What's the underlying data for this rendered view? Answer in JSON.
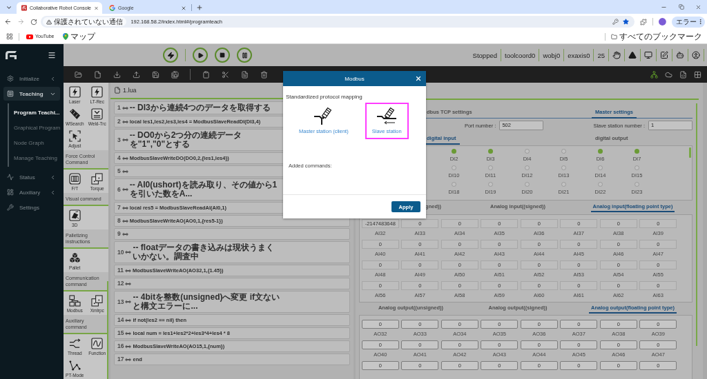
{
  "browser": {
    "tabs": [
      {
        "title": "Collaborative Robot Console",
        "selected": true
      },
      {
        "title": "Google",
        "selected": false
      }
    ],
    "security_label": "保護されていない通信",
    "url": "192.168.58.2/index.html#/programteach",
    "profile_label": "エラー",
    "bookmarks": [
      {
        "label": "YouTube"
      },
      {
        "label": "マップ"
      }
    ],
    "all_bookmarks": "すべてのブックマーク"
  },
  "sidebar": {
    "items": [
      {
        "label": "Initialize",
        "selected": false,
        "expanded": false
      },
      {
        "label": "Teaching",
        "selected": true,
        "expanded": true,
        "children": [
          {
            "label": "Program Teachi...",
            "selected": true
          },
          {
            "label": "Graphical Program",
            "selected": false
          },
          {
            "label": "Node Graph",
            "selected": false
          },
          {
            "label": "Manage Teaching",
            "selected": false
          }
        ]
      },
      {
        "label": "Status",
        "selected": false,
        "expanded": false
      },
      {
        "label": "Auxiliary",
        "selected": false,
        "expanded": false
      },
      {
        "label": "Settings",
        "selected": false
      }
    ]
  },
  "header": {
    "status": [
      "Stopped",
      "toolcoord0",
      "wobj0",
      "exaxis0",
      "25"
    ]
  },
  "command_panel": {
    "groups": [
      {
        "commands": [
          "Laser",
          "LT-Rec",
          "WSearch",
          "Weld-Trc",
          "Adjust"
        ]
      },
      {
        "title": "Force Control Command",
        "commands": [
          "F/T",
          "Torque"
        ]
      },
      {
        "title": "Visual command",
        "commands": [
          "3D"
        ]
      },
      {
        "title": "Palletizing instructions",
        "commands": [
          "Pallet"
        ]
      },
      {
        "title": "Communication command",
        "commands": [
          "Modbus",
          "Xmlrpc"
        ]
      },
      {
        "title": "Auxiliary command",
        "commands": [
          "Thread",
          "Function",
          "PT-Mode"
        ]
      }
    ]
  },
  "editor": {
    "file": "1.lua",
    "lines": [
      {
        "number": "1",
        "kind": "comment",
        "code": "-- DI3から連続4つのデータを取得する"
      },
      {
        "number": "2",
        "kind": "code",
        "code": "local les1,les2,les3,les4 = ModbusSlaveReadDI(DI3,4)"
      },
      {
        "number": "3",
        "kind": "comment",
        "code": "-- DO0から2つ分の連続データを\"1\",\"0\"とする"
      },
      {
        "number": "4",
        "kind": "code",
        "code": "ModbusSlaveWriteDO(DO0,2,{les1,les4})"
      },
      {
        "number": "5",
        "kind": "blank"
      },
      {
        "number": "6",
        "kind": "comment",
        "code": "-- AI0(ushort)を読み取り、その値から1を引いた数をA..."
      },
      {
        "number": "7",
        "kind": "code",
        "code": "local res5 = ModbusSlaveReadAI(AI0,1)"
      },
      {
        "number": "8",
        "kind": "code",
        "code": "ModbusSlaveWriteAO(AO0,1,{res5-1})"
      },
      {
        "number": "9",
        "kind": "blank"
      },
      {
        "number": "10",
        "kind": "comment",
        "code": "-- floatデータの書き込みは現状うまくいかない。調査中"
      },
      {
        "number": "11",
        "kind": "code",
        "code": "ModbusSlaveWriteAO(AO32,1,{1.45})"
      },
      {
        "number": "12",
        "kind": "blank"
      },
      {
        "number": "13",
        "kind": "comment",
        "code": "-- 4bitを整数(unsigned)へ変更 if文ないと構文エラーに..."
      },
      {
        "number": "14",
        "kind": "code",
        "code": "if not(les2 == nil) then"
      },
      {
        "number": "15",
        "kind": "code",
        "code": "local num = les1+les2*2+les3*4+les4 * 8"
      },
      {
        "number": "16",
        "kind": "code",
        "code": "ModbusSlaveWriteAO(AO15,1,{num})"
      },
      {
        "number": "17",
        "kind": "code",
        "code": "end"
      }
    ]
  },
  "io_panel": {
    "tabs": [
      {
        "label": "dbus TCP settings",
        "selected": false
      },
      {
        "label": "Master settings",
        "selected": true
      }
    ],
    "port": {
      "label": "Port number :",
      "value": "502"
    },
    "slave": {
      "label": "Slave station number :",
      "value": "1"
    },
    "digital_tabs": [
      {
        "label": "digital input",
        "selected": true
      },
      {
        "label": "digital output",
        "selected": false
      }
    ],
    "digital_inputs": [
      {
        "label": "DI2",
        "on": true
      },
      {
        "label": "DI3",
        "on": true
      },
      {
        "label": "DI4",
        "on": false
      },
      {
        "label": "DI5",
        "on": false
      },
      {
        "label": "DI6",
        "on": true
      },
      {
        "label": "DI7",
        "on": true
      },
      {
        "label": "DI10",
        "on": false
      },
      {
        "label": "DI11",
        "on": false
      },
      {
        "label": "DI12",
        "on": false
      },
      {
        "label": "DI13",
        "on": false
      },
      {
        "label": "DI14",
        "on": false
      },
      {
        "label": "DI15",
        "on": false
      },
      {
        "label": "DI18",
        "on": false
      },
      {
        "label": "DI19",
        "on": false
      },
      {
        "label": "DI20",
        "on": false
      },
      {
        "label": "DI21",
        "on": false
      },
      {
        "label": "DI22",
        "on": false
      },
      {
        "label": "DI23",
        "on": false
      }
    ],
    "analog_input_tabs": [
      {
        "label": "gned))",
        "selected": false
      },
      {
        "label": "Analog input((signed))",
        "selected": false
      },
      {
        "label": "Analog input(floating point type)",
        "selected": true
      }
    ],
    "analog_inputs": [
      {
        "label": "AI32",
        "value": "-2147483648"
      },
      {
        "label": "AI33",
        "value": "0"
      },
      {
        "label": "AI34",
        "value": "0"
      },
      {
        "label": "AI35",
        "value": "0"
      },
      {
        "label": "AI36",
        "value": "0"
      },
      {
        "label": "AI37",
        "value": "0"
      },
      {
        "label": "AI38",
        "value": "0"
      },
      {
        "label": "AI39",
        "value": "0"
      },
      {
        "label": "AI40",
        "value": "0"
      },
      {
        "label": "AI41",
        "value": "0"
      },
      {
        "label": "AI42",
        "value": "0"
      },
      {
        "label": "AI43",
        "value": "0"
      },
      {
        "label": "AI44",
        "value": "0"
      },
      {
        "label": "AI45",
        "value": "0"
      },
      {
        "label": "AI46",
        "value": "0"
      },
      {
        "label": "AI47",
        "value": "0"
      },
      {
        "label": "AI48",
        "value": "0"
      },
      {
        "label": "AI49",
        "value": "0"
      },
      {
        "label": "AI50",
        "value": "0"
      },
      {
        "label": "AI51",
        "value": "0"
      },
      {
        "label": "AI52",
        "value": "0"
      },
      {
        "label": "AI53",
        "value": "0"
      },
      {
        "label": "AI54",
        "value": "0"
      },
      {
        "label": "AI55",
        "value": "0"
      },
      {
        "label": "AI56",
        "value": "0"
      },
      {
        "label": "AI57",
        "value": "0"
      },
      {
        "label": "AI58",
        "value": "0"
      },
      {
        "label": "AI59",
        "value": "0"
      },
      {
        "label": "AI60",
        "value": "0"
      },
      {
        "label": "AI61",
        "value": "0"
      },
      {
        "label": "AI62",
        "value": "0"
      },
      {
        "label": "AI63",
        "value": "0"
      }
    ],
    "analog_output_tabs": [
      {
        "label": "Analog output((unsigned))",
        "selected": false
      },
      {
        "label": "Analog output((signed))",
        "selected": false
      },
      {
        "label": "Analog output(floating point type)",
        "selected": true
      }
    ],
    "analog_outputs": [
      {
        "label": "AO32",
        "value": "0"
      },
      {
        "label": "AO33",
        "value": "0"
      },
      {
        "label": "AO34",
        "value": "0"
      },
      {
        "label": "AO35",
        "value": "0"
      },
      {
        "label": "AO36",
        "value": "0"
      },
      {
        "label": "AO37",
        "value": "0"
      },
      {
        "label": "AO38",
        "value": "0"
      },
      {
        "label": "AO39",
        "value": "0"
      },
      {
        "label": "AO40",
        "value": "0"
      },
      {
        "label": "AO41",
        "value": "0"
      },
      {
        "label": "AO42",
        "value": "0"
      },
      {
        "label": "AO43",
        "value": "0"
      },
      {
        "label": "AO44",
        "value": "0"
      },
      {
        "label": "AO45",
        "value": "0"
      },
      {
        "label": "AO46",
        "value": "0"
      },
      {
        "label": "AO47",
        "value": "0"
      },
      {
        "value": "0"
      },
      {
        "value": "0"
      },
      {
        "value": "0"
      },
      {
        "value": "0"
      },
      {
        "value": "0"
      },
      {
        "value": "0"
      },
      {
        "value": "0"
      },
      {
        "value": "0"
      }
    ]
  },
  "modal": {
    "title": "Modbus",
    "section": "Standardized protocol mapping",
    "options": [
      {
        "label": "Master station (client)",
        "selected": false
      },
      {
        "label": "Slave station",
        "selected": true
      }
    ],
    "added_label": "Added commands:",
    "apply": "Apply"
  }
}
